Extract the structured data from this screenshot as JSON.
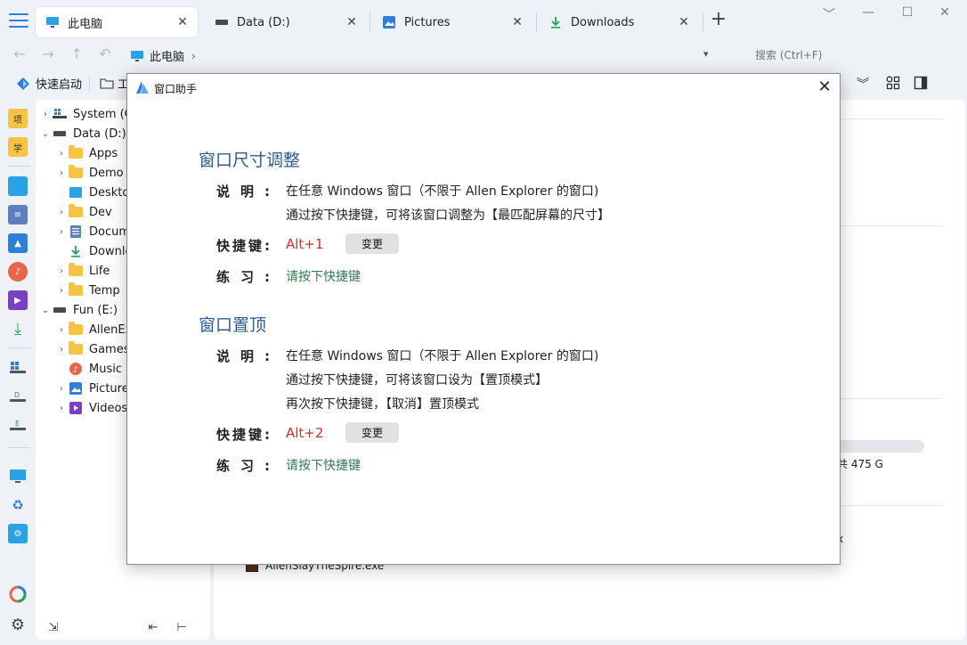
{
  "tabs": [
    {
      "label": "此电脑",
      "icon": "computer-icon",
      "close": "✕"
    },
    {
      "label": "Data (D:)",
      "icon": "drive-icon",
      "close": "✕"
    },
    {
      "label": "Pictures",
      "icon": "pictures-icon",
      "close": "✕"
    },
    {
      "label": "Downloads",
      "icon": "downloads-icon",
      "close": "✕"
    }
  ],
  "new_tab": "+",
  "window_controls": {
    "collapse": "﹀",
    "minimize": "—",
    "maximize": "☐",
    "close": "✕"
  },
  "address": {
    "crumb": "此电脑",
    "chevron": "›",
    "search_placeholder": "搜索 (Ctrl+F)"
  },
  "toolbar": {
    "quick_launch": "快速启动",
    "tools_partial": "工"
  },
  "icon_column": {
    "item1": "项",
    "item2": "学"
  },
  "tree": [
    {
      "label": "System (C",
      "arrow": "›",
      "icon": "windows-drive-icon"
    },
    {
      "label": "Data (D:)",
      "arrow": "⌄",
      "icon": "drive-icon"
    },
    {
      "label": "Apps",
      "arrow": "›",
      "icon": "folder-icon"
    },
    {
      "label": "Demo",
      "arrow": "›",
      "icon": "folder-icon"
    },
    {
      "label": "Deskto",
      "arrow": "",
      "icon": "desktop-icon"
    },
    {
      "label": "Dev",
      "arrow": "›",
      "icon": "folder-icon"
    },
    {
      "label": "Docum",
      "arrow": "›",
      "icon": "document-icon"
    },
    {
      "label": "Downlo",
      "arrow": "",
      "icon": "download-icon"
    },
    {
      "label": "Life",
      "arrow": "›",
      "icon": "folder-icon"
    },
    {
      "label": "Temp",
      "arrow": "›",
      "icon": "folder-icon"
    },
    {
      "label": "Fun (E:)",
      "arrow": "⌄",
      "icon": "drive-icon"
    },
    {
      "label": "AllenEx",
      "arrow": "›",
      "icon": "folder-icon"
    },
    {
      "label": "Games",
      "arrow": "›",
      "icon": "folder-icon"
    },
    {
      "label": "Music",
      "arrow": "",
      "icon": "music-icon"
    },
    {
      "label": "Picture",
      "arrow": "›",
      "icon": "pictures-icon"
    },
    {
      "label": "Videos",
      "arrow": "›",
      "icon": "videos-icon"
    }
  ],
  "content": {
    "disk_text": "共 475 G",
    "ex_tail": "x",
    "file_name": "AllenSlayTheSpire.exe"
  },
  "dialog": {
    "title": "窗口助手",
    "close": "✕",
    "sections": [
      {
        "heading": "窗口尺寸调整",
        "desc_label": "说明:",
        "desc_lines": [
          "在任意 Windows 窗口（不限于 Allen Explorer 的窗口)",
          "通过按下快捷键，可将该窗口调整为【最匹配屏幕的尺寸】"
        ],
        "hotkey_label": "快捷键:",
        "hotkey": "Alt+1",
        "change": "变更",
        "practice_label": "练习:",
        "practice": "请按下快捷键"
      },
      {
        "heading": "窗口置顶",
        "desc_label": "说明:",
        "desc_lines": [
          "在任意 Windows 窗口（不限于 Allen Explorer 的窗口)",
          "通过按下快捷键，可将该窗口设为【置顶模式】",
          "再次按下快捷键，【取消】置顶模式"
        ],
        "hotkey_label": "快捷键:",
        "hotkey": "Alt+2",
        "change": "变更",
        "practice_label": "练习:",
        "practice": "请按下快捷键"
      }
    ]
  },
  "colors": {
    "accent": "#2f7fd6",
    "heading": "#2c5c96",
    "hotkey": "#d62b2b",
    "practice": "#2e7d4f"
  }
}
